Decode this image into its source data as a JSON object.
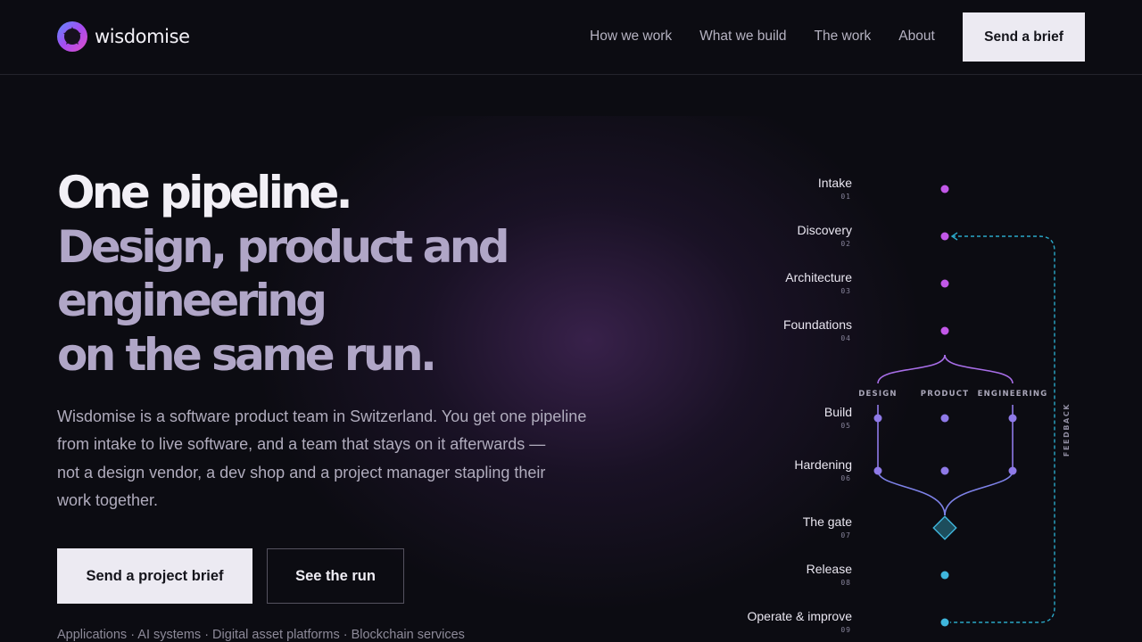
{
  "brand": {
    "name": "wisdomise"
  },
  "nav": {
    "items": [
      "How we work",
      "What we build",
      "The work",
      "About"
    ],
    "cta": "Send a brief"
  },
  "hero": {
    "line1": "One pipeline.",
    "line2": "Design, product and",
    "line3": "engineering",
    "line4": "on the same run.",
    "lead": [
      "Wisdomise is a software product team in Switzerland. You get one pipeline",
      "from intake to live software, and a team that stays on it afterwards —",
      "not a design vendor, a dev shop and a project manager stapling their",
      "work together."
    ],
    "primary_cta": "Send a project brief",
    "secondary_cta": "See the run",
    "services": "Applications · AI systems · Digital asset platforms · Blockchain services"
  },
  "pipeline": {
    "stages": [
      {
        "name": "Intake",
        "num": "01"
      },
      {
        "name": "Discovery",
        "num": "02"
      },
      {
        "name": "Architecture",
        "num": "03"
      },
      {
        "name": "Foundations",
        "num": "04"
      },
      {
        "name": "Build",
        "num": "05"
      },
      {
        "name": "Hardening",
        "num": "06"
      },
      {
        "name": "The gate",
        "num": "07"
      },
      {
        "name": "Release",
        "num": "08"
      },
      {
        "name": "Operate & improve",
        "num": "09"
      }
    ],
    "tracks": [
      "DESIGN",
      "PRODUCT",
      "ENGINEERING"
    ],
    "feedback_label": "FEEDBACK",
    "colors": {
      "early": "#c258e8",
      "mid": "#8f7ae8",
      "late": "#3fb6dc",
      "feedback": "#2aa8c8"
    }
  }
}
